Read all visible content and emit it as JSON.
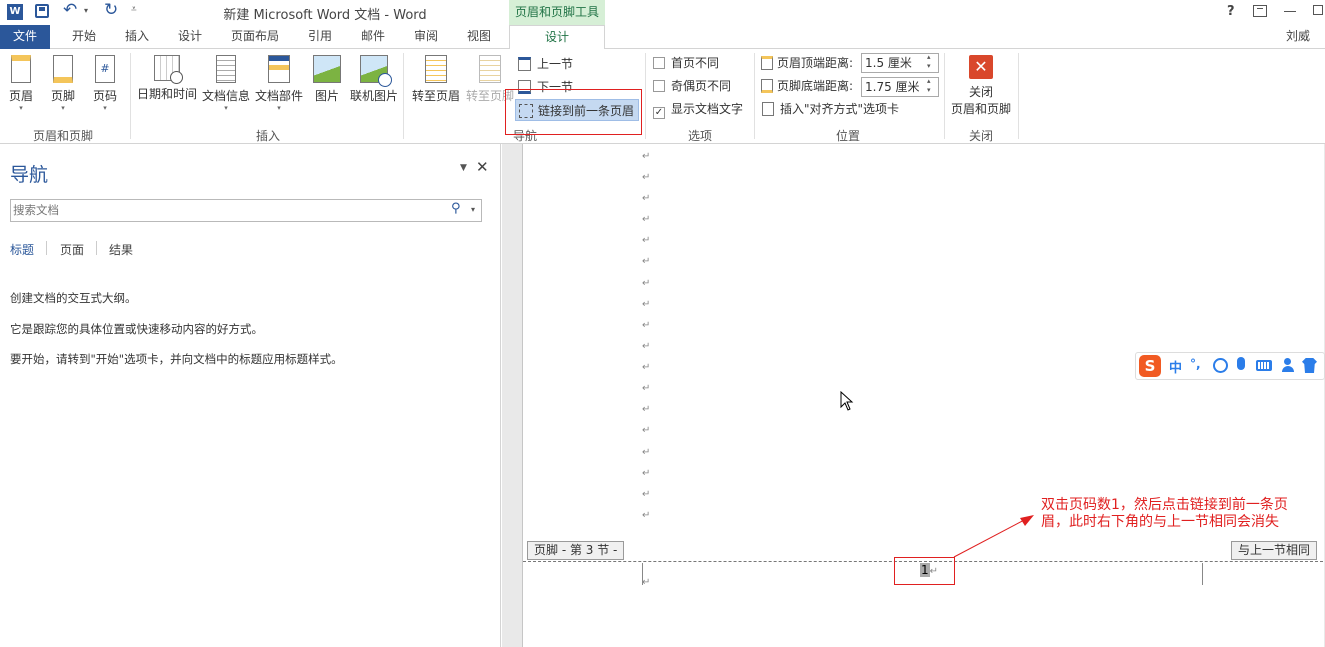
{
  "titlebar": {
    "title": "新建 Microsoft Word 文档 - Word",
    "context_tab_title": "页眉和页脚工具",
    "help": "?",
    "app_icon": "W"
  },
  "tabs": {
    "file": "文件",
    "home": "开始",
    "insert": "插入",
    "design1": "设计",
    "layout": "页面布局",
    "references": "引用",
    "mailings": "邮件",
    "review": "审阅",
    "view": "视图",
    "design2": "设计",
    "user": "刘威"
  },
  "ribbon": {
    "header": "页眉",
    "footer": "页脚",
    "page_number": "页码",
    "group_header_footer": "页眉和页脚",
    "date_time": "日期和时间",
    "doc_info": "文档信息",
    "doc_parts": "文档部件",
    "picture": "图片",
    "online_picture": "联机图片",
    "group_insert": "插入",
    "goto_header": "转至页眉",
    "goto_footer": "转至页脚",
    "prev_section": "上一节",
    "next_section": "下一节",
    "link_previous": "链接到前一条页眉",
    "group_nav": "导航",
    "diff_first": "首页不同",
    "diff_odd_even": "奇偶页不同",
    "show_text": "显示文档文字",
    "group_options": "选项",
    "header_top_label": "页眉顶端距离:",
    "header_top_value": "1.5 厘米",
    "footer_bottom_label": "页脚底端距离:",
    "footer_bottom_value": "1.75 厘米",
    "insert_align_tab": "插入\"对齐方式\"选项卡",
    "group_position": "位置",
    "close_line1": "关闭",
    "close_line2": "页眉和页脚",
    "group_close": "关闭"
  },
  "nav": {
    "title": "导航",
    "search_placeholder": "搜索文档",
    "tab_headings": "标题",
    "tab_pages": "页面",
    "tab_results": "结果",
    "para1": "创建文档的交互式大纲。",
    "para2": "它是跟踪您的具体位置或快速移动内容的好方式。",
    "para3": "要开始，请转到\"开始\"选项卡，并向文档中的标题应用标题样式。"
  },
  "document": {
    "paragraph_mark": "↵",
    "footer_label": "页脚 - 第 3 节 -",
    "same_as_prev": "与上一节相同",
    "page_number": "1",
    "annotation_line1": "双击页码数1，然后点击链接到前一条页",
    "annotation_line2": "眉，此时右下角的与上一节相同会消失"
  },
  "ime": {
    "logo": "S",
    "lang": "中",
    "punct": "°,"
  },
  "colors": {
    "word_blue": "#2b579a",
    "context_green": "#217346",
    "annotation_red": "#e02020"
  }
}
